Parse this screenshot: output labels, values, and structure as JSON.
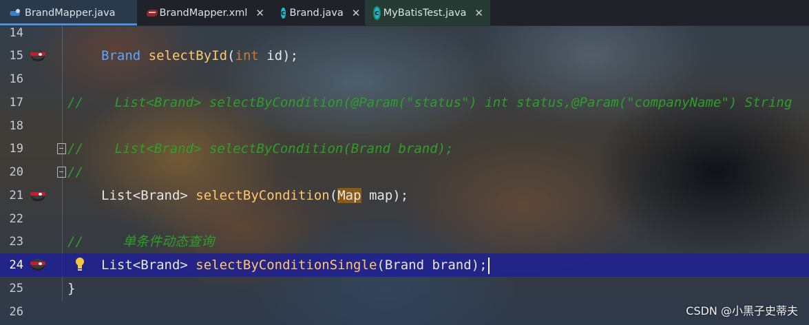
{
  "tabs": [
    {
      "label": "BrandMapper.java",
      "icon": "mapper-interface-icon",
      "active": true
    },
    {
      "label": "BrandMapper.xml",
      "icon": "mybatis-xml-icon",
      "active": false
    },
    {
      "label": "Brand.java",
      "icon": "class-icon",
      "active": false
    },
    {
      "label": "MyBatisTest.java",
      "icon": "test-class-icon",
      "active": false
    }
  ],
  "close_glyph": "✕",
  "class_glyph": "c",
  "lines": [
    {
      "num": "14"
    },
    {
      "num": "15",
      "gutter": "mybatis-bird-icon",
      "tokens": [
        "Brand",
        "selectById",
        "(",
        "int",
        " id);"
      ]
    },
    {
      "num": "16"
    },
    {
      "num": "17",
      "comment": "//    List<Brand> selectByCondition(@Param(\"status\") int status,@Param(\"companyName\") String"
    },
    {
      "num": "18"
    },
    {
      "num": "19",
      "fold": true,
      "comment": "//    List<Brand> selectByCondition(Brand brand);"
    },
    {
      "num": "20",
      "fold": true,
      "comment": "//"
    },
    {
      "num": "21",
      "gutter": "mybatis-bird-icon",
      "tokens": [
        "List<Brand> ",
        "selectByCondition",
        "(",
        "Map",
        " map);"
      ]
    },
    {
      "num": "22"
    },
    {
      "num": "23",
      "comment": "//     单条件动态查询"
    },
    {
      "num": "24",
      "current": true,
      "gutter": "mybatis-bird-icon",
      "intention": "lightbulb-icon",
      "tokens": [
        "List<Brand> ",
        "selectByConditionSingle",
        "(Brand brand);"
      ]
    },
    {
      "num": "25",
      "tokens": [
        "}"
      ]
    },
    {
      "num": "26"
    }
  ],
  "watermark": "CSDN @小黑子史蒂夫",
  "colors": {
    "keyword": "#cc7832",
    "type": "#58a6ff",
    "method": "#ffc66d",
    "comment": "#2e9e2a",
    "current_line": "#1e2096",
    "active_tab_underline": "#4a90e2"
  }
}
